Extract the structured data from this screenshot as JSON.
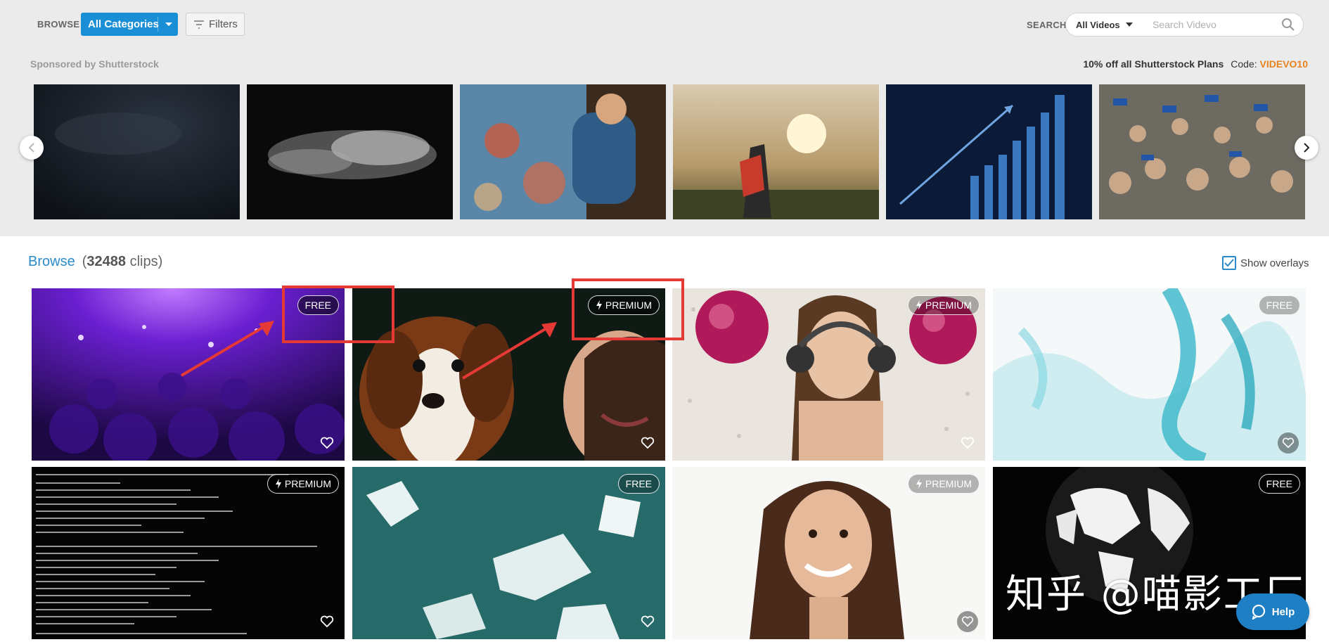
{
  "header": {
    "browse_label": "BROWSE",
    "category_button": "All Categories",
    "filters_button": "Filters",
    "search_label": "SEARCH",
    "search_scope": "All Videos",
    "search_placeholder": "Search Videvo"
  },
  "sponsored": {
    "label": "Sponsored by Shutterstock",
    "promo_text": "10% off all Shutterstock Plans",
    "code_label": "Code:",
    "code_value": "VIDEVO10"
  },
  "carousel": {
    "thumbnails": [
      "dark-smoke",
      "white-smoke",
      "painting-woman",
      "sunset-celebration",
      "growth-chart",
      "cheering-crowd"
    ]
  },
  "browse": {
    "title": "Browse",
    "count_open": "(",
    "count": "32488",
    "count_suffix": "clips)",
    "show_overlays_label": "Show overlays",
    "show_overlays_checked": true
  },
  "clips": [
    {
      "badge": "FREE",
      "subject": "concert-crowd-purple"
    },
    {
      "badge": "PREMIUM",
      "subject": "dog-and-woman"
    },
    {
      "badge": "PREMIUM",
      "subject": "dj-woman-headphones"
    },
    {
      "badge": "FREE",
      "subject": "cyan-smoke"
    },
    {
      "badge": "PREMIUM",
      "subject": "terminal-output"
    },
    {
      "badge": "FREE",
      "subject": "ice-floes"
    },
    {
      "badge": "PREMIUM",
      "subject": "smiling-woman"
    },
    {
      "badge": "FREE",
      "subject": "rotating-globe"
    }
  ],
  "watermark": "知乎 @喵影工厂",
  "help_button": "Help",
  "colors": {
    "accent": "#1a8fd6",
    "promo_code": "#e8821e",
    "annotation": "#e53935",
    "link": "#2b8bc9"
  }
}
